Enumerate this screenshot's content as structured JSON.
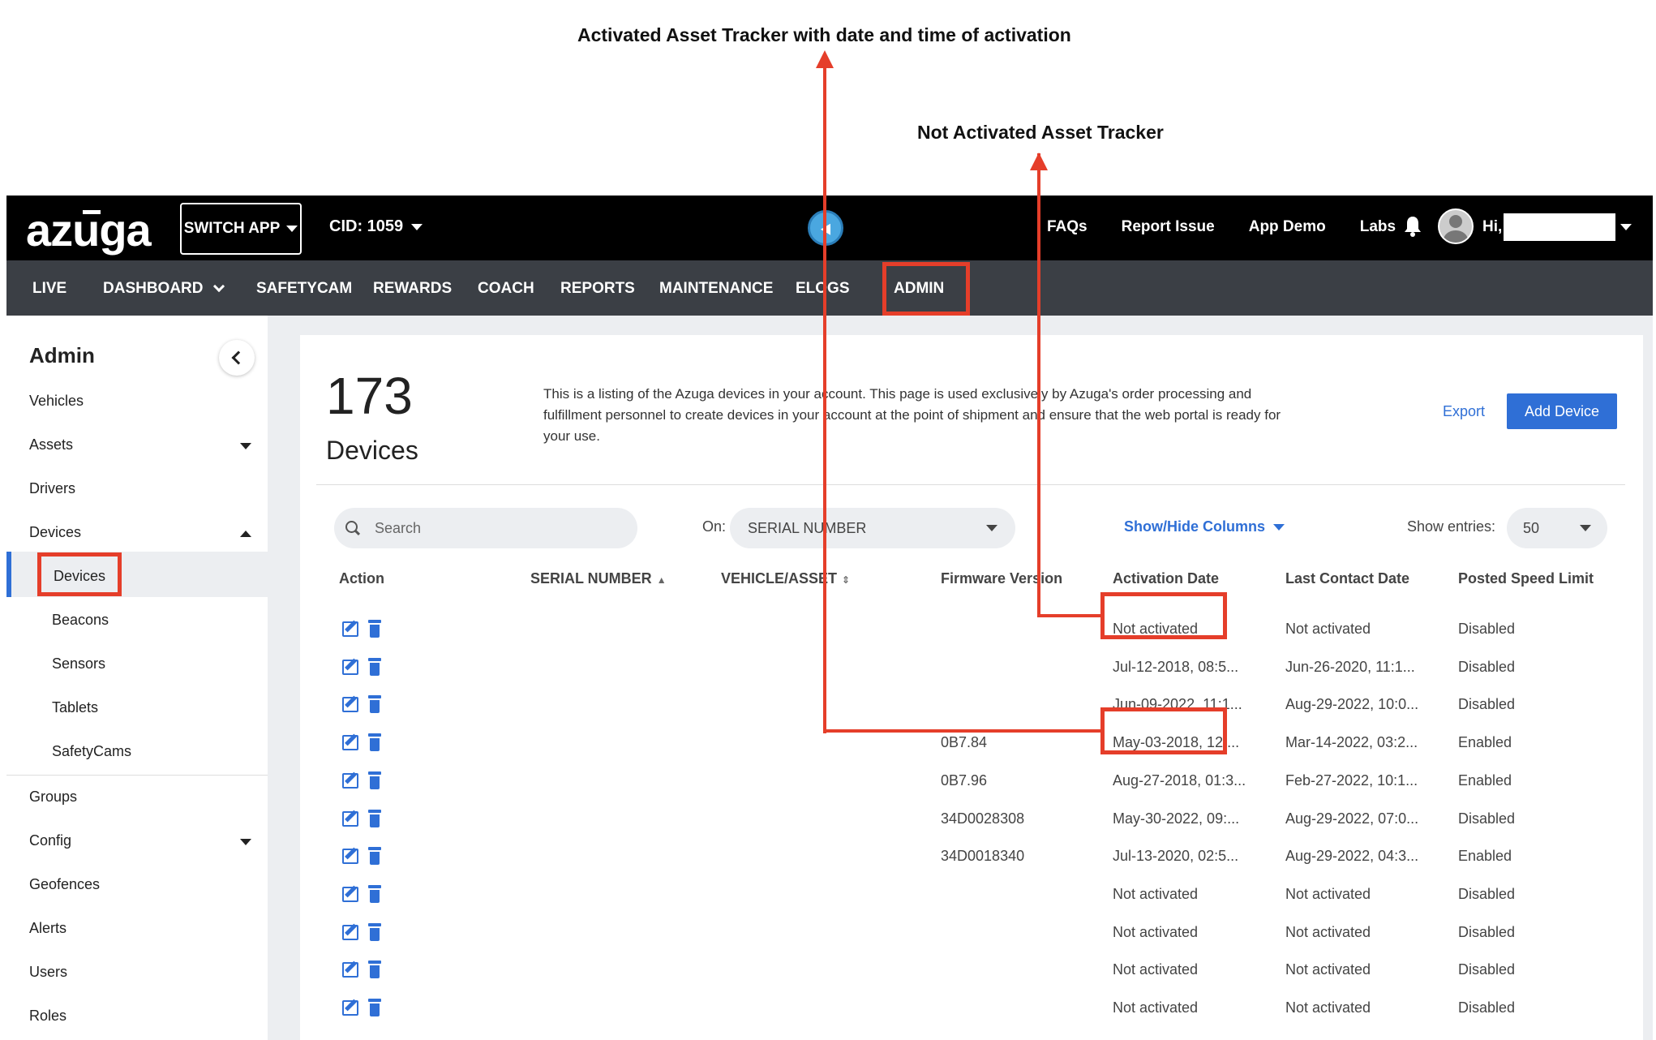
{
  "annotations": {
    "activated_label": "Activated Asset Tracker with date and time of activation",
    "not_activated_label": "Not Activated Asset Tracker"
  },
  "topbar": {
    "logo": "azuga",
    "switch_app": "SWITCH APP",
    "cid": "CID: 1059",
    "links": [
      "FAQs",
      "Report Issue",
      "App Demo",
      "Labs"
    ],
    "greeting": "Hi,"
  },
  "nav": {
    "items": [
      "LIVE",
      "DASHBOARD",
      "SAFETYCAM",
      "REWARDS",
      "COACH",
      "REPORTS",
      "MAINTENANCE",
      "ELOGS",
      "ADMIN"
    ],
    "active": "ADMIN"
  },
  "sidebar": {
    "title": "Admin",
    "items": [
      "Vehicles",
      "Assets",
      "Drivers",
      "Devices"
    ],
    "sub_items": [
      "Devices",
      "Beacons",
      "Sensors",
      "Tablets",
      "SafetyCams"
    ],
    "items_after": [
      "Groups",
      "Config",
      "Geofences",
      "Alerts",
      "Users",
      "Roles"
    ],
    "active_sub": "Devices"
  },
  "main": {
    "count": "173",
    "count_label": "Devices",
    "description": "This is a listing of the Azuga devices in your account. This page is used exclusively by Azuga's order processing and fulfillment personnel to create devices in your account at the point of shipment and ensure that the web portal is ready for your use.",
    "export_label": "Export",
    "add_device_label": "Add Device",
    "search_placeholder": "Search",
    "on_label": "On:",
    "on_value": "SERIAL NUMBER",
    "show_hide_label": "Show/Hide Columns",
    "show_entries_label": "Show entries:",
    "show_entries_value": "50"
  },
  "table": {
    "columns": [
      "Action",
      "SERIAL NUMBER",
      "VEHICLE/ASSET",
      "Firmware Version",
      "Activation Date",
      "Last Contact Date",
      "Posted Speed Limit"
    ],
    "rows": [
      {
        "firmware": "",
        "activation": "Not activated",
        "last_contact": "Not activated",
        "speed": "Disabled"
      },
      {
        "firmware": "",
        "activation": "Jul-12-2018, 08:5...",
        "last_contact": "Jun-26-2020, 11:1...",
        "speed": "Disabled"
      },
      {
        "firmware": "",
        "activation": "Jun-09-2022, 11:1...",
        "last_contact": "Aug-29-2022, 10:0...",
        "speed": "Disabled"
      },
      {
        "firmware": "0B7.84",
        "activation": "May-03-2018, 12:...",
        "last_contact": "Mar-14-2022, 03:2...",
        "speed": "Enabled"
      },
      {
        "firmware": "0B7.96",
        "activation": "Aug-27-2018, 01:3...",
        "last_contact": "Feb-27-2022, 10:1...",
        "speed": "Enabled"
      },
      {
        "firmware": "34D0028308",
        "activation": "May-30-2022, 09:...",
        "last_contact": "Aug-29-2022, 07:0...",
        "speed": "Disabled"
      },
      {
        "firmware": "34D0018340",
        "activation": "Jul-13-2020, 02:5...",
        "last_contact": "Aug-29-2022, 04:3...",
        "speed": "Enabled"
      },
      {
        "firmware": "",
        "activation": "Not activated",
        "last_contact": "Not activated",
        "speed": "Disabled"
      },
      {
        "firmware": "",
        "activation": "Not activated",
        "last_contact": "Not activated",
        "speed": "Disabled"
      },
      {
        "firmware": "",
        "activation": "Not activated",
        "last_contact": "Not activated",
        "speed": "Disabled"
      },
      {
        "firmware": "",
        "activation": "Not activated",
        "last_contact": "Not activated",
        "speed": "Disabled"
      }
    ]
  },
  "colors": {
    "accent": "#2f6fd6",
    "highlight": "#e53e2a",
    "topbar": "#000000",
    "navbar": "#3b3f45"
  }
}
